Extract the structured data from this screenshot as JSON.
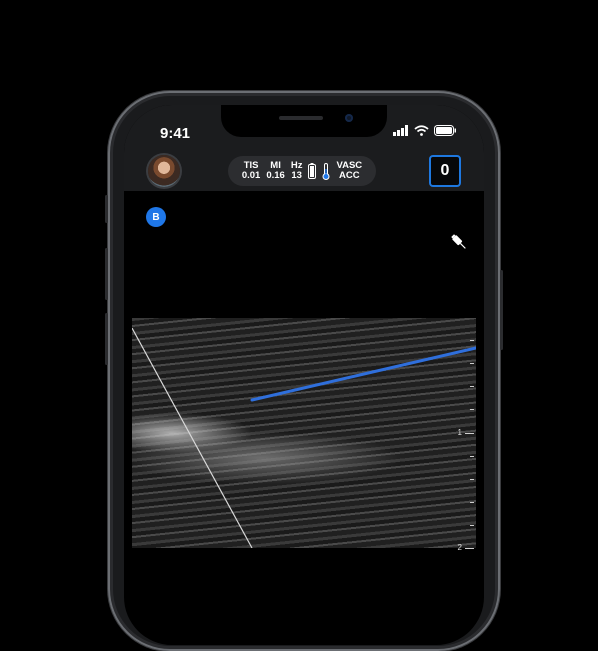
{
  "status_bar": {
    "time": "9:41"
  },
  "header": {
    "metrics": [
      {
        "label": "TIS",
        "value": "0.01"
      },
      {
        "label": "MI",
        "value": "0.16"
      },
      {
        "label": "Hz",
        "value": "13"
      }
    ],
    "preset_line1": "VASC",
    "preset_line2": "ACC",
    "frame_count": "0"
  },
  "mode_badge": "B",
  "depth_scale": {
    "labels": [
      "1",
      "2"
    ]
  },
  "colors": {
    "accent": "#1f77e8",
    "needle": "#2f6fdc"
  },
  "icons": [
    "signal-icon",
    "wifi-icon",
    "battery-icon",
    "thermometer-icon",
    "needle-icon",
    "avatar"
  ]
}
